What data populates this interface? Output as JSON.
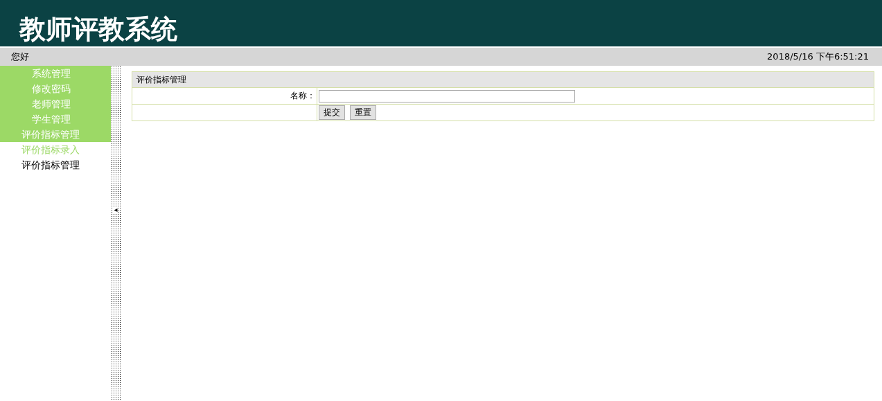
{
  "header": {
    "title": "教师评教系统"
  },
  "status_bar": {
    "greeting": "您好",
    "datetime": "2018/5/16 下午6:51:21"
  },
  "sidebar": {
    "menu": [
      {
        "label": "系统管理",
        "kind": "heading"
      },
      {
        "label": "修改密码",
        "kind": "heading"
      },
      {
        "label": "老师管理",
        "kind": "heading"
      },
      {
        "label": "学生管理",
        "kind": "heading"
      },
      {
        "label": "评价指标管理",
        "kind": "group",
        "children": [
          {
            "label": "评价指标录入",
            "selected": true
          },
          {
            "label": "评价指标管理",
            "selected": false
          }
        ]
      }
    ]
  },
  "splitter": {
    "collapse_symbol": "◂"
  },
  "panel": {
    "title": "评价指标管理",
    "fields": [
      {
        "label": "名称："
      }
    ],
    "buttons": [
      "提交",
      "重置"
    ]
  }
}
